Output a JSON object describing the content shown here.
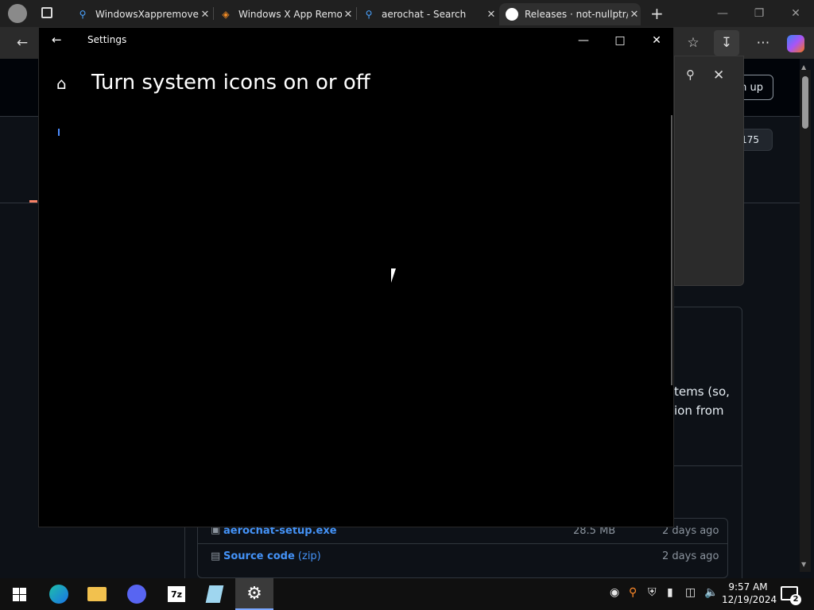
{
  "browser": {
    "tabs": [
      {
        "title": "WindowsXappremove",
        "icon": "bing-search-icon"
      },
      {
        "title": "Windows X App Remo",
        "icon": "app-remover-icon"
      },
      {
        "title": "aerochat - Search",
        "icon": "bing-search-icon"
      },
      {
        "title": "Releases · not-nullptr/A",
        "icon": "github-icon"
      }
    ],
    "signup_button": "Sign up",
    "star_count": "175"
  },
  "background_page": {
    "text_line1": "tems (so,",
    "text_line2": "ion from",
    "assets": [
      {
        "name": "aerochat-setup.exe",
        "size": "28.5 MB",
        "date": "2 days ago"
      },
      {
        "name": "Source code",
        "suffix": "(zip)",
        "date": "2 days ago"
      }
    ]
  },
  "settings": {
    "window_title": "Settings",
    "page_title": "Turn system icons on or off"
  },
  "taskbar": {
    "time": "9:57 AM",
    "date": "12/19/2024",
    "notification_count": "2",
    "apps": [
      "windows-start-icon",
      "edge-icon",
      "file-explorer-icon",
      "discord-app-icon",
      "7zip-icon",
      "notepad-icon",
      "settings-gear-icon"
    ]
  },
  "colors": {
    "accent": "#4493f8",
    "settings_bg": "#000000",
    "taskbar_bg": "#101010"
  }
}
